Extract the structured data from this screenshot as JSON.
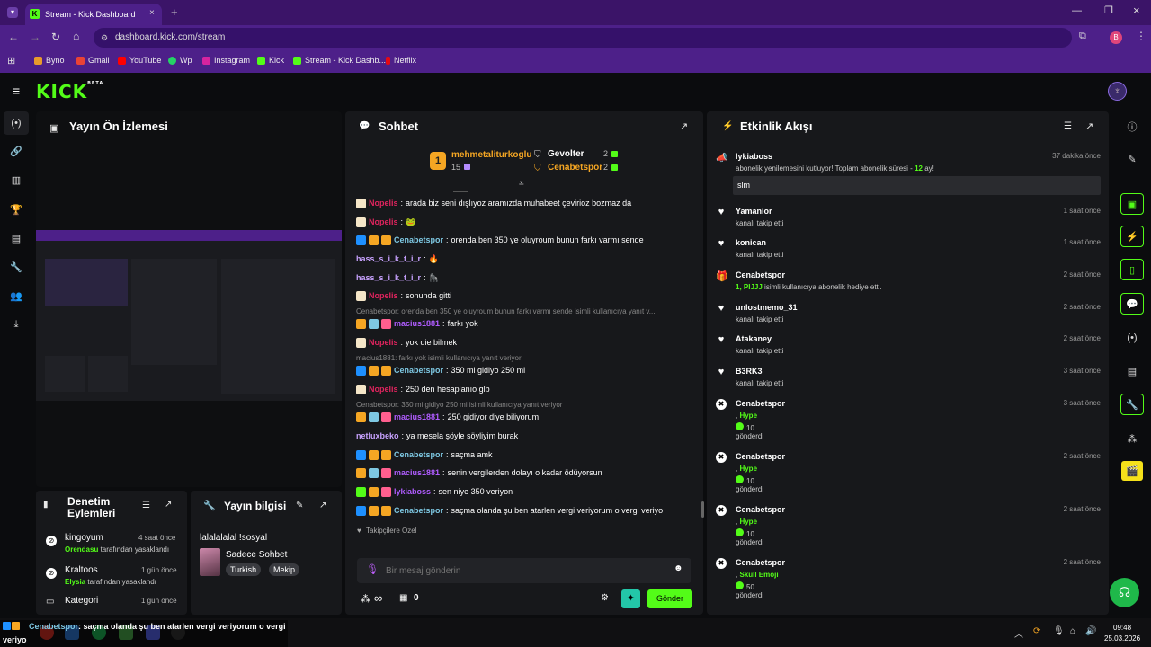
{
  "browser": {
    "tab_title": "Stream - Kick Dashboard",
    "url": "dashboard.kick.com/stream",
    "profile_initial": "B",
    "bookmarks": [
      {
        "label": "Byno",
        "color": "#e89b2b"
      },
      {
        "label": "Gmail",
        "color": "#ea4335"
      },
      {
        "label": "YouTube",
        "color": "#ff0000"
      },
      {
        "label": "Wp",
        "color": "#25d366"
      },
      {
        "label": "Instagram",
        "color": "#d6249f"
      },
      {
        "label": "Kick",
        "color": "#53fc18"
      },
      {
        "label": "Stream - Kick Dashb...",
        "color": "#53fc18"
      },
      {
        "label": "Netflix",
        "color": "#e50914"
      }
    ]
  },
  "app": {
    "logo": "KICK",
    "logo_tag": "BETA"
  },
  "preview": {
    "title": "Yayın Ön İzlemesi"
  },
  "mod_actions": {
    "title_line1": "Denetim",
    "title_line2": "Eylemleri",
    "items": [
      {
        "user": "kingoyum",
        "time": "4 saat önce",
        "actor": "Orendasu",
        "action": "tarafından yasaklandı"
      },
      {
        "user": "Kraltoos",
        "time": "1 gün önce",
        "actor": "Elysia",
        "action": "tarafından yasaklandı"
      },
      {
        "user": "Kategori",
        "time": "1 gün önce"
      }
    ]
  },
  "stream_info": {
    "title": "Yayın bilgisi",
    "stream_title": "lalalalalal !sosyal",
    "category": "Sadece Sohbet",
    "tags": [
      "Turkish",
      "Mekip"
    ]
  },
  "chat": {
    "title": "Sohbet",
    "leaderboard": [
      {
        "rank": "1",
        "name": "mehmetaliturkoglu",
        "count": "15"
      },
      {
        "name": "Gevolter",
        "count": "2"
      },
      {
        "name": "Cenabetspor",
        "count": "2"
      }
    ],
    "messages": [
      {
        "type": "msg",
        "user": "Nopelis",
        "ucolor": "#e0245e",
        "text": "arada biz seni dışlıyoz aramızda muhabeet çevirioz bozmaz da",
        "badges": [
          "#f5e6c8"
        ]
      },
      {
        "type": "msg",
        "user": "Nopelis",
        "ucolor": "#e0245e",
        "text": "🐸",
        "badges": [
          "#f5e6c8"
        ]
      },
      {
        "type": "msg",
        "user": "Cenabetspor",
        "ucolor": "#7ec8e3",
        "text": "orenda ben 350 ye oluyroum bunun farkı varmı sende",
        "badges": [
          "#1e90ff",
          "#f5a623",
          "#f5a623"
        ]
      },
      {
        "type": "msg",
        "user": "hass_s_i_k_t_i_r",
        "ucolor": "#c8a2ff",
        "text": "🔥",
        "badges": []
      },
      {
        "type": "msg",
        "user": "hass_s_i_k_t_i_r",
        "ucolor": "#c8a2ff",
        "text": "🦍",
        "badges": []
      },
      {
        "type": "msg",
        "user": "Nopelis",
        "ucolor": "#e0245e",
        "text": "sonunda gitti",
        "badges": [
          "#f5e6c8"
        ]
      },
      {
        "type": "reply",
        "text": "Cenabetspor: orenda ben 350 ye oluyroum bunun farkı varmı sende isimli kullanıcıya yanıt v..."
      },
      {
        "type": "msg",
        "user": "macius1881",
        "ucolor": "#b05cff",
        "text": "farkı yok",
        "badges": [
          "#f5a623",
          "#7ec8e3",
          "#ff5f8f"
        ]
      },
      {
        "type": "msg",
        "user": "Nopelis",
        "ucolor": "#e0245e",
        "text": "yok die bilmek",
        "badges": [
          "#f5e6c8"
        ]
      },
      {
        "type": "reply",
        "text": "macius1881: farkı yok isimli kullanıcıya yanıt veriyor"
      },
      {
        "type": "msg",
        "user": "Cenabetspor",
        "ucolor": "#7ec8e3",
        "text": "350 mi gidiyo 250 mi",
        "badges": [
          "#1e90ff",
          "#f5a623",
          "#f5a623"
        ]
      },
      {
        "type": "msg",
        "user": "Nopelis",
        "ucolor": "#e0245e",
        "text": "250 den hesaplanıo glb",
        "badges": [
          "#f5e6c8"
        ]
      },
      {
        "type": "reply",
        "text": "Cenabetspor: 350 mi gidiyo 250 mi isimli kullanıcıya yanıt veriyor"
      },
      {
        "type": "msg",
        "user": "macius1881",
        "ucolor": "#b05cff",
        "text": "250 gidiyor diye biliyorum",
        "badges": [
          "#f5a623",
          "#7ec8e3",
          "#ff5f8f"
        ]
      },
      {
        "type": "msg",
        "user": "netluxbeko",
        "ucolor": "#c8a2ff",
        "text": "ya mesela şöyle söyliyim burak",
        "badges": []
      },
      {
        "type": "msg",
        "user": "Cenabetspor",
        "ucolor": "#7ec8e3",
        "text": "saçma amk",
        "badges": [
          "#1e90ff",
          "#f5a623",
          "#f5a623"
        ]
      },
      {
        "type": "msg",
        "user": "macius1881",
        "ucolor": "#b05cff",
        "text": "senin vergilerden dolayı o kadar ödüyorsun",
        "badges": [
          "#f5a623",
          "#7ec8e3",
          "#ff5f8f"
        ]
      },
      {
        "type": "msg",
        "user": "lykiaboss",
        "ucolor": "#b05cff",
        "text": "sen niye 350 veriyon",
        "badges": [
          "#53fc18",
          "#f5a623",
          "#ff5f8f"
        ]
      },
      {
        "type": "msg",
        "user": "Cenabetspor",
        "ucolor": "#7ec8e3",
        "text": "saçma olanda şu ben atarlen vergi veriyorum o vergi veriyo",
        "badges": [
          "#1e90ff",
          "#f5a623",
          "#f5a623"
        ]
      }
    ],
    "emote_label": "Takipçilere Özel",
    "emotes": [
      "#3cc43c",
      "#b8889a",
      "#d84a3a",
      "#5ed15e",
      "#3cc43c",
      "#4ad14a",
      "#3cc43c",
      "#3cc43c",
      "#d89a3a",
      "#3cc43c"
    ],
    "input_placeholder": "Bir mesaj gönderin",
    "points": "∞",
    "viewers": "0",
    "send_label": "Gönder"
  },
  "activity": {
    "title": "Etkinlik Akışı",
    "events": [
      {
        "icon": "📣",
        "user": "lykiaboss",
        "time": "37 dakika önce",
        "sub": "abonelik yenilemesini kutluyor! Toplam abonelik süresi - ",
        "sub_green": "12",
        "sub_tail": " ay!",
        "message": "slm"
      },
      {
        "icon": "♥",
        "user": "Yamanior",
        "time": "1 saat önce",
        "sub": "kanalı takip etti"
      },
      {
        "icon": "♥",
        "user": "konican",
        "time": "1 saat önce",
        "sub": "kanalı takip etti"
      },
      {
        "icon": "🎁",
        "user": "Cenabetspor",
        "time": "2 saat önce",
        "sub_green": "1, PIJJJ",
        "sub": " isimli kullanıcıya abonelik hediye etti."
      },
      {
        "icon": "♥",
        "user": "unlostmemo_31",
        "time": "2 saat önce",
        "sub": "kanalı takip etti"
      },
      {
        "icon": "♥",
        "user": "Atakaney",
        "time": "2 saat önce",
        "sub": "kanalı takip etti"
      },
      {
        "icon": "♥",
        "user": "B3RK3",
        "time": "3 saat önce",
        "sub": "kanalı takip etti"
      },
      {
        "icon": "✖",
        "user": "Cenabetspor",
        "time": "3 saat önce",
        "kick": "Hype",
        "amount": "10",
        "sent": "gönderdi"
      },
      {
        "icon": "✖",
        "user": "Cenabetspor",
        "time": "2 saat önce",
        "kick": "Hype",
        "amount": "10",
        "sent": "gönderdi"
      },
      {
        "icon": "✖",
        "user": "Cenabetspor",
        "time": "2 saat önce",
        "kick": "Hype",
        "amount": "10",
        "sent": "gönderdi"
      },
      {
        "icon": "✖",
        "user": "Cenabetspor",
        "time": "2 saat önce",
        "kick": "Skull Emoji",
        "amount": "50",
        "sent": "gönderdi"
      }
    ]
  },
  "toast": {
    "user": "Cenabetspor",
    "text": ": saçma olanda şu ben atarlen vergi veriyorum o vergi",
    "text2": "veriyo"
  },
  "taskbar": {
    "time": "09:48",
    "date": "25.03.2026"
  }
}
